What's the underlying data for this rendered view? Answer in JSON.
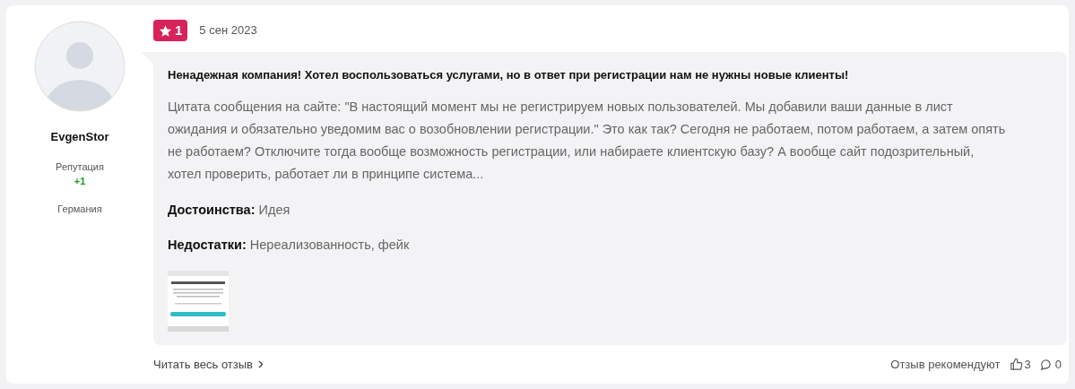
{
  "author": {
    "name": "EvgenStor",
    "reputation_label": "Репутация",
    "reputation_value": "+1",
    "country": "Германия"
  },
  "rating": {
    "value": "1",
    "color": "#d6245a"
  },
  "date": "5 сен 2023",
  "review": {
    "title": "Ненадежная компания! Хотел воспользоваться услугами, но в ответ при регистрации нам не нужны новые клиенты!",
    "body": "Цитата сообщения на сайте: \"В настоящий момент мы не регистрируем новых пользователей. Мы добавили ваши данные в лист ожидания и обязательно уведомим вас о возобновлении регистрации.\" Это как так? Сегодня не работаем, потом работаем, а затем опять не работаем? Отключите тогда вообще возможность регистрации, или набираете клиентскую базу? А вообще сайт подозрительный, хотел проверить, работает ли в принципе система...",
    "pros": {
      "label": "Достоинства:",
      "text": "Идея"
    },
    "cons": {
      "label": "Недостатки:",
      "text": "Нереализованность, фейк"
    }
  },
  "footer": {
    "read_more": "Читать весь отзыв",
    "recommend_label": "Отзыв рекомендуют",
    "likes": "3",
    "comments": "0"
  }
}
